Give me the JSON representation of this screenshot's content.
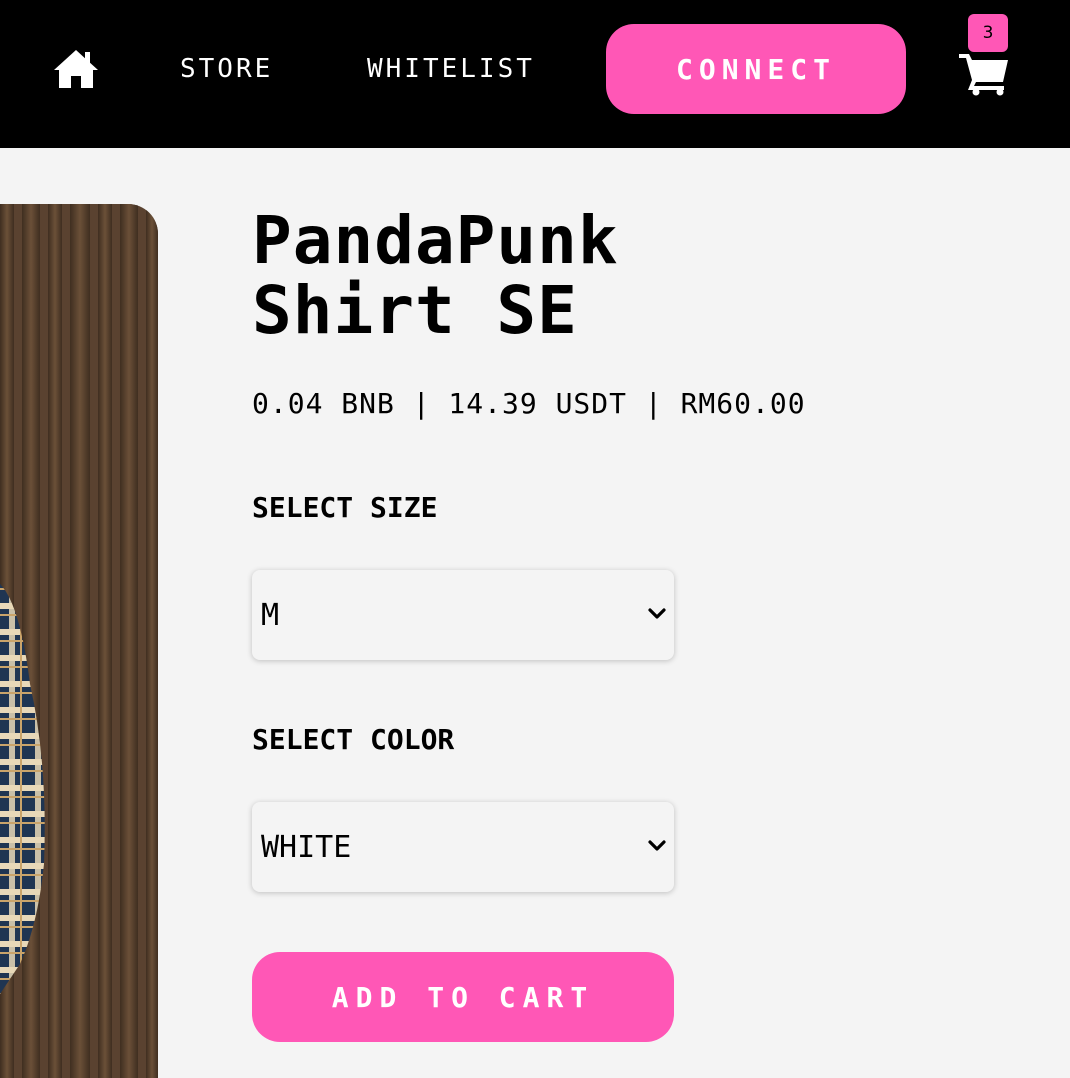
{
  "header": {
    "home_icon": "home-icon",
    "nav": [
      {
        "label": "STORE"
      },
      {
        "label": "WHITELIST"
      }
    ],
    "connect_label": "CONNECT",
    "cart_icon": "shopping-cart-icon",
    "cart_count": "3"
  },
  "product": {
    "title_line1": "PandaPunk",
    "title_line2": "Shirt SE",
    "price": "0.04 BNB | 14.39 USDT | RM60.00",
    "size_label": "SELECT SIZE",
    "size_value": "M",
    "color_label": "SELECT COLOR",
    "color_value": "WHITE",
    "add_to_cart_label": "ADD TO CART"
  },
  "colors": {
    "header_bg": "#000000",
    "accent_pink": "#ff57b6",
    "page_bg": "#f4f4f4"
  }
}
